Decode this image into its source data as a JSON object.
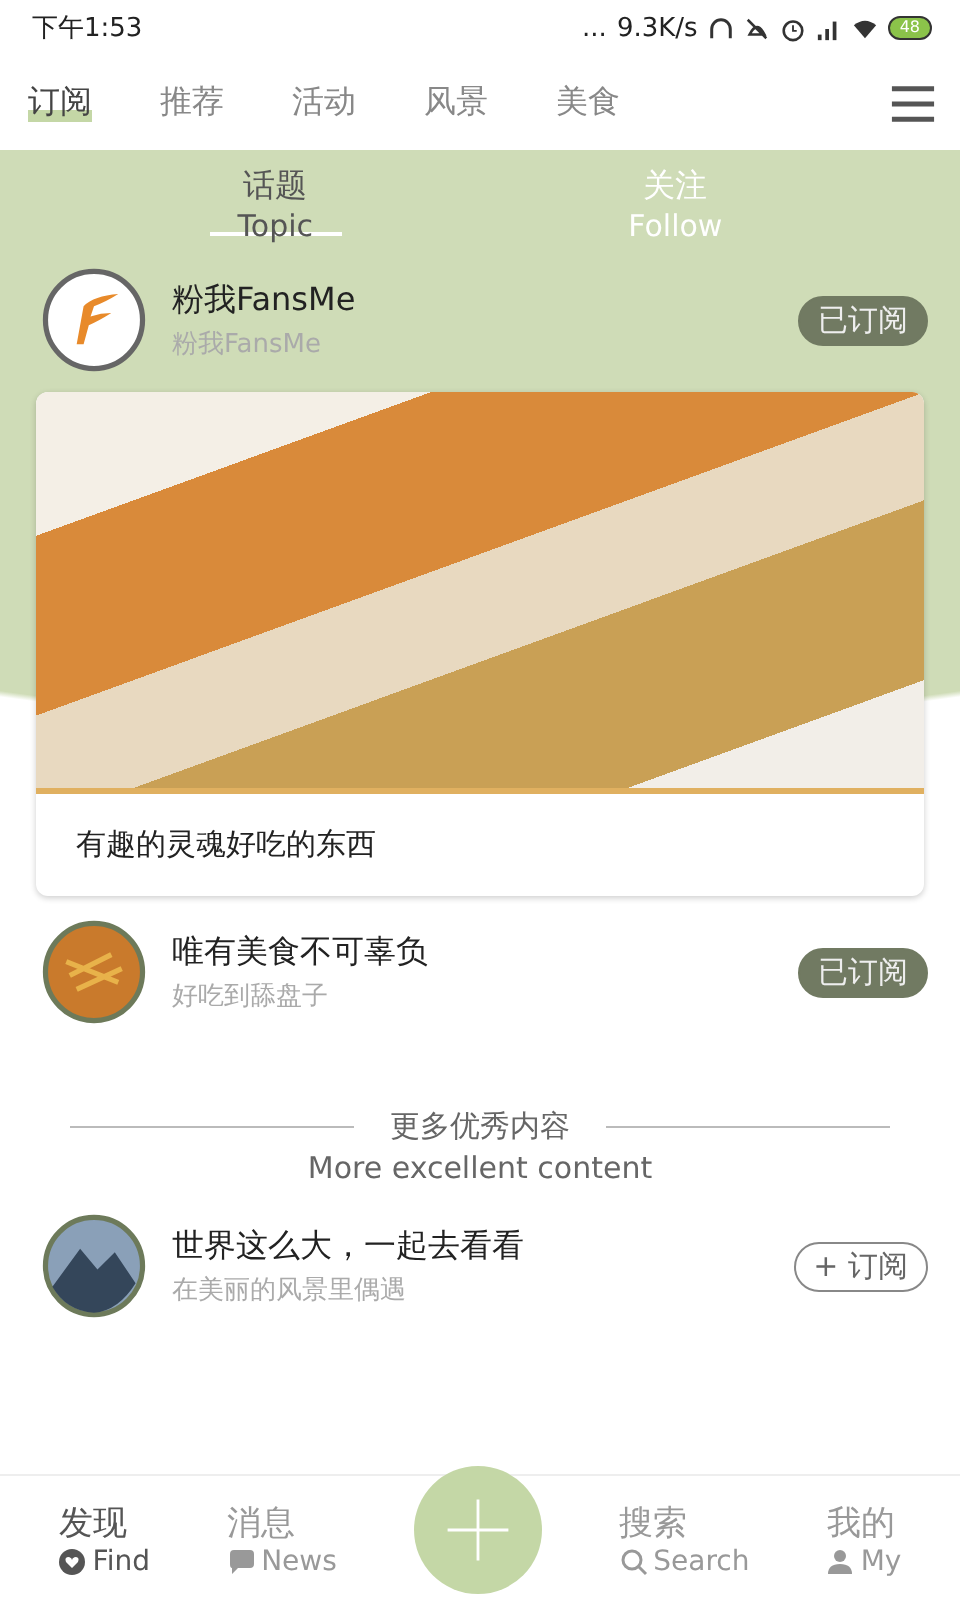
{
  "status_bar": {
    "time": "下午1:53",
    "dots": "...",
    "net_speed": "9.3K/s",
    "battery": "48"
  },
  "top_tabs": [
    {
      "label": "订阅",
      "selected": true
    },
    {
      "label": "推荐",
      "selected": false
    },
    {
      "label": "活动",
      "selected": false
    },
    {
      "label": "风景",
      "selected": false
    },
    {
      "label": "美食",
      "selected": false
    }
  ],
  "sub_tabs": [
    {
      "label": "话题",
      "sublabel": "Topic",
      "selected": true
    },
    {
      "label": "关注",
      "sublabel": "Follow",
      "selected": false
    }
  ],
  "subscriptions": [
    {
      "name": "粉我FansMe",
      "subtitle": "粉我FansMe",
      "subscribed": true,
      "button": "已订阅",
      "post": {
        "caption": "有趣的灵魂好吃的东西"
      }
    },
    {
      "name": "唯有美食不可辜负",
      "subtitle": "好吃到舔盘子",
      "subscribed": true,
      "button": "已订阅"
    }
  ],
  "more_section": {
    "title": "更多优秀内容",
    "subtitle": "More excellent content"
  },
  "recommended": [
    {
      "name": "世界这么大，一起去看看",
      "subtitle": "在美丽的风景里偶遇",
      "subscribed": false,
      "button": "+ 订阅"
    }
  ],
  "bottom_nav": [
    {
      "kind": "tab",
      "label": "发现",
      "sublabel": "Find",
      "selected": true
    },
    {
      "kind": "tab",
      "label": "消息",
      "sublabel": "News",
      "selected": false
    },
    {
      "kind": "add"
    },
    {
      "kind": "tab",
      "label": "搜索",
      "sublabel": "Search",
      "selected": false
    },
    {
      "kind": "tab",
      "label": "我的",
      "sublabel": "My",
      "selected": false
    }
  ]
}
